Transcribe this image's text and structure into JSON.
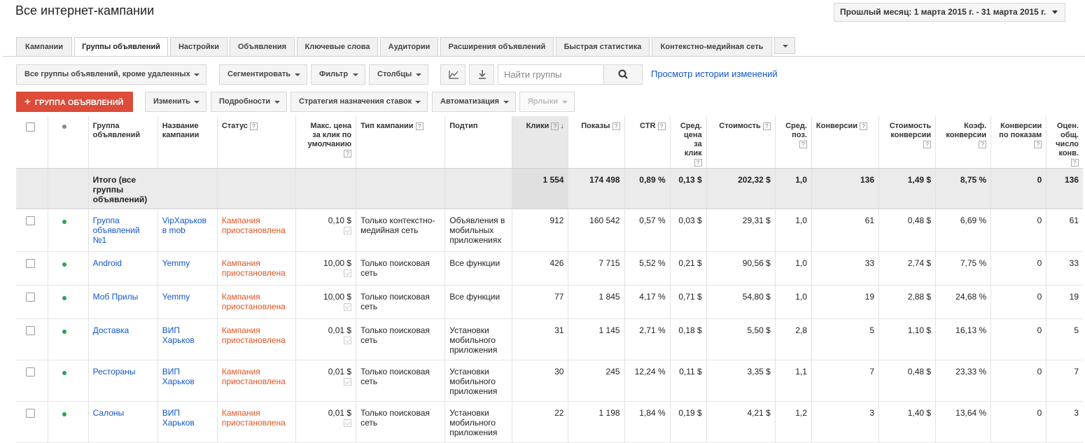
{
  "page": {
    "title": "Все интернет-кампании",
    "date_range": "Прошлый месяц: 1 марта 2015 г. - 31 марта 2015 г."
  },
  "tabs": [
    "Кампании",
    "Группы объявлений",
    "Настройки",
    "Объявления",
    "Ключевые слова",
    "Аудитории",
    "Расширения объявлений",
    "Быстрая статистика",
    "Контекстно-медийная сеть"
  ],
  "toolbar": {
    "filter_scope": "Все группы объявлений, кроме удаленных",
    "segment": "Сегментировать",
    "filter": "Фильтр",
    "columns": "Столбцы",
    "search_placeholder": "Найти группы",
    "history_link": "Просмотр истории изменений"
  },
  "actions": {
    "add": "ГРУППА ОБЪЯВЛЕНИЙ",
    "edit": "Изменить",
    "details": "Подробности",
    "bid_strategy": "Стратегия назначения ставок",
    "automate": "Автоматизация",
    "labels": "Ярлыки"
  },
  "columns": {
    "group": "Группа объявлений",
    "campaign": "Название кампании",
    "status": "Статус",
    "max_cpc": "Макс. цена за клик по умолчанию",
    "campaign_type": "Тип кампании",
    "subtype": "Подтип",
    "clicks": "Клики",
    "impressions": "Показы",
    "ctr": "CTR",
    "avg_cpc": "Сред. цена за клик",
    "cost": "Стоимость",
    "avg_pos": "Сред. поз.",
    "conversions": "Конверсии",
    "cost_conv": "Стоимость конверсии",
    "conv_rate": "Коэф. конверсии",
    "view_conv": "Конверсии по показам",
    "est_conv": "Оцен. общ. число конв."
  },
  "total": {
    "label": "Итого (все группы объявлений)",
    "clicks": "1 554",
    "impressions": "174 498",
    "ctr": "0,89 %",
    "avg_cpc": "0,13 $",
    "cost": "202,32 $",
    "avg_pos": "1,0",
    "conversions": "136",
    "cost_conv": "1,49 $",
    "conv_rate": "8,75 %",
    "view_conv": "0",
    "est_conv": "136"
  },
  "rows": [
    {
      "group": "Группа объявлений №1",
      "campaign": "VipХарьков в mob",
      "status": "Кампания приостановлена",
      "max_cpc": "0,10 $",
      "campaign_type": "Только контекстно-медийная сеть",
      "subtype": "Объявления в мобильных приложениях",
      "clicks": "912",
      "impressions": "160 542",
      "ctr": "0,57 %",
      "avg_cpc": "0,03 $",
      "cost": "29,31 $",
      "avg_pos": "1,0",
      "conversions": "61",
      "cost_conv": "0,48 $",
      "conv_rate": "6,69 %",
      "view_conv": "0",
      "est_conv": "61"
    },
    {
      "group": "Android",
      "campaign": "Yemmy",
      "status": "Кампания приостановлена",
      "max_cpc": "10,00 $",
      "campaign_type": "Только поисковая сеть",
      "subtype": "Все функции",
      "clicks": "426",
      "impressions": "7 715",
      "ctr": "5,52 %",
      "avg_cpc": "0,21 $",
      "cost": "90,56 $",
      "avg_pos": "1,0",
      "conversions": "33",
      "cost_conv": "2,74 $",
      "conv_rate": "7,75 %",
      "view_conv": "0",
      "est_conv": "33"
    },
    {
      "group": "Моб Прилы",
      "campaign": "Yemmy",
      "status": "Кампания приостановлена",
      "max_cpc": "10,00 $",
      "campaign_type": "Только поисковая сеть",
      "subtype": "Все функции",
      "clicks": "77",
      "impressions": "1 845",
      "ctr": "4,17 %",
      "avg_cpc": "0,71 $",
      "cost": "54,80 $",
      "avg_pos": "1,0",
      "conversions": "19",
      "cost_conv": "2,88 $",
      "conv_rate": "24,68 %",
      "view_conv": "0",
      "est_conv": "19"
    },
    {
      "group": "Доставка",
      "campaign": "ВИП Харьков",
      "status": "Кампания приостановлена",
      "max_cpc": "0,01 $",
      "campaign_type": "Только поисковая сеть",
      "subtype": "Установки мобильного приложения",
      "clicks": "31",
      "impressions": "1 145",
      "ctr": "2,71 %",
      "avg_cpc": "0,18 $",
      "cost": "5,50 $",
      "avg_pos": "2,8",
      "conversions": "5",
      "cost_conv": "1,10 $",
      "conv_rate": "16,13 %",
      "view_conv": "0",
      "est_conv": "5"
    },
    {
      "group": "Рестораны",
      "campaign": "ВИП Харьков",
      "status": "Кампания приостановлена",
      "max_cpc": "0,01 $",
      "campaign_type": "Только поисковая сеть",
      "subtype": "Установки мобильного приложения",
      "clicks": "30",
      "impressions": "245",
      "ctr": "12,24 %",
      "avg_cpc": "0,11 $",
      "cost": "3,35 $",
      "avg_pos": "1,1",
      "conversions": "7",
      "cost_conv": "0,48 $",
      "conv_rate": "23,33 %",
      "view_conv": "0",
      "est_conv": "7"
    },
    {
      "group": "Салоны",
      "campaign": "ВИП Харьков",
      "status": "Кампания приостановлена",
      "max_cpc": "0,01 $",
      "campaign_type": "Только поисковая сеть",
      "subtype": "Установки мобильного приложения",
      "clicks": "22",
      "impressions": "1 198",
      "ctr": "1,84 %",
      "avg_cpc": "0,19 $",
      "cost": "4,21 $",
      "avg_pos": "1,2",
      "conversions": "3",
      "cost_conv": "1,40 $",
      "conv_rate": "13,64 %",
      "view_conv": "0",
      "est_conv": "3"
    }
  ],
  "colors": {
    "accent": "#dd4b39",
    "link": "#1155cc",
    "paused": "#e6511f",
    "enabled_dot": "#2ca05a"
  }
}
